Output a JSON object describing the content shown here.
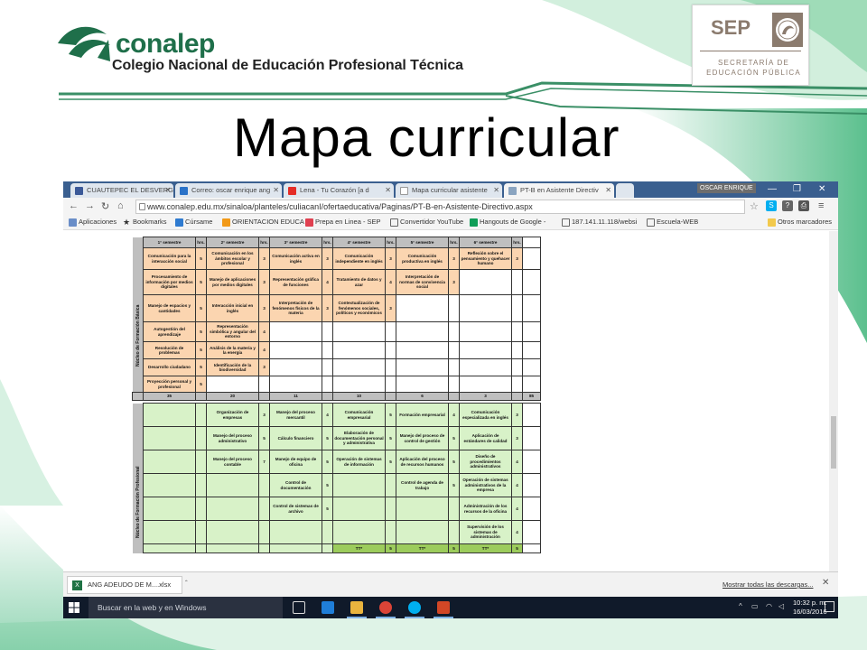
{
  "slide": {
    "title": "Mapa  curricular",
    "org_name": "conalep",
    "org_full_name": "Colegio Nacional de Educación Profesional Técnica",
    "sep_acronym": "SEP",
    "sep_line1": "SECRETARÍA DE",
    "sep_line2": "EDUCACIÓN PÚBLICA",
    "colors": {
      "brand_green": "#1f6f4a",
      "swoosh_green": "#3fb57a",
      "sep_brown": "#8b7b6e"
    }
  },
  "browser": {
    "tabs": [
      {
        "label": "CUAUTEPEC EL DESVERGI",
        "icon": "facebook-icon"
      },
      {
        "label": "Correo: oscar enrique ang",
        "icon": "mail-icon"
      },
      {
        "label": "Lena - Tu Corazón [a d",
        "icon": "youtube-icon"
      },
      {
        "label": "Mapa curricular asistente",
        "icon": "google-icon"
      },
      {
        "label": "PT-B en Asistente Directiv",
        "icon": "page-icon"
      }
    ],
    "user": "OSCAR ENRIQUE",
    "url": "www.conalep.edu.mx/sinaloa/planteles/culiacanI/ofertaeducativa/Paginas/PT-B-en-Asistente-Directivo.aspx",
    "bookmarks": [
      "Aplicaciones",
      "Bookmarks",
      "Cúrsame",
      "ORIENTACION EDUCA",
      "Prepa en Linea - SEP",
      "Convertidor YouTube",
      "Hangouts de Google -",
      "187.141.11.118/websi",
      "Escuela-WEB"
    ],
    "other_bookmarks": "Otros marcadores"
  },
  "curriculum": {
    "headers": [
      "1° semestre",
      "hrs.",
      "2° semestre",
      "hrs.",
      "3° semestre",
      "hrs.",
      "4° semestre",
      "hrs.",
      "5° semestre",
      "hrs.",
      "6° semestre",
      "hrs."
    ],
    "basic_label": "Núcleo de Formación Básica",
    "professional_label": "Núcleo de Formación Profesional",
    "basic_rows": [
      [
        "Comunicación para la interacción social",
        "5",
        "Comunicación en los ámbitos escolar y profesional",
        "3",
        "Comunicación activa en inglés",
        "3",
        "Comunicación independiente en inglés",
        "3",
        "Comunicación productiva en inglés",
        "3",
        "Reflexión sobre el pensamiento y quehacer humano",
        "3"
      ],
      [
        "Procesamiento de información por medios digitales",
        "5",
        "Manejo de aplicaciones por medios digitales",
        "3",
        "Representación gráfica de funciones",
        "4",
        "Tratamiento de datos y azar",
        "4",
        "Interpretación de normas de convivencia social",
        "3",
        "",
        ""
      ],
      [
        "Manejo de espacios y cantidades",
        "5",
        "Interacción inicial en inglés",
        "3",
        "Interpretación de fenómenos físicos de la materia",
        "3",
        "Contextualización de fenómenos sociales, políticos y económicos",
        "3",
        "",
        "",
        "",
        ""
      ],
      [
        "Autogestión del aprendizaje",
        "5",
        "Representación simbólica y angular del entorno",
        "4",
        "",
        "",
        "",
        "",
        "",
        "",
        "",
        ""
      ],
      [
        "Resolución de problemas",
        "5",
        "Análisis de la materia y la energía",
        "4",
        "",
        "",
        "",
        "",
        "",
        "",
        "",
        ""
      ],
      [
        "Desarrollo ciudadano",
        "5",
        "Identificación de la biodiversidad",
        "3",
        "",
        "",
        "",
        "",
        "",
        "",
        "",
        ""
      ],
      [
        "Proyección personal y profesional",
        "5",
        "",
        "",
        "",
        "",
        "",
        "",
        "",
        "",
        "",
        ""
      ]
    ],
    "basic_totals": [
      "35",
      "20",
      "11",
      "10",
      "6",
      "3"
    ],
    "grand_total": "85",
    "professional_rows": [
      [
        "",
        "",
        "Organización de empresas",
        "3",
        "Manejo del proceso mercantil",
        "4",
        "Comunicación empresarial",
        "5",
        "Formación empresarial",
        "4",
        "Comunicación especializada en inglés",
        "3"
      ],
      [
        "",
        "",
        "Manejo del proceso administrativo",
        "5",
        "Cálculo financiero",
        "5",
        "Elaboración de documentación personal y administrativa",
        "5",
        "Manejo del proceso de control de gestión",
        "5",
        "Aplicación de estándares de calidad",
        "3"
      ],
      [
        "",
        "",
        "Manejo del proceso contable",
        "7",
        "Manejo de equipo de oficina",
        "5",
        "Operación de sistemas de información",
        "5",
        "Aplicación del proceso de recursos humanos",
        "5",
        "Diseño de procedimientos administrativos",
        "4"
      ],
      [
        "",
        "",
        "",
        "",
        "Control de documentación",
        "5",
        "",
        "",
        "Control de agenda de trabajo",
        "5",
        "Operación de sistemas administrativos de la empresa",
        "4"
      ],
      [
        "",
        "",
        "",
        "",
        "Control de sistemas de archivo",
        "5",
        "",
        "",
        "",
        "",
        "Administración de los recursos de la oficina",
        "4"
      ],
      [
        "",
        "",
        "",
        "",
        "",
        "",
        "",
        "",
        "",
        "",
        "Supervisión de los sistemas de administración",
        "4"
      ],
      [
        "",
        "",
        "",
        "",
        "",
        "",
        "TT*",
        "5",
        "TT*",
        "5",
        "TT*",
        "5"
      ]
    ]
  },
  "downloads": {
    "file": "ANG ADEUDO DE M....xlsx",
    "show_all": "Mostrar todas las descargas..."
  },
  "taskbar": {
    "search_placeholder": "Buscar en la web y en Windows",
    "time": "10:32 p. m.",
    "date": "16/03/2016"
  }
}
